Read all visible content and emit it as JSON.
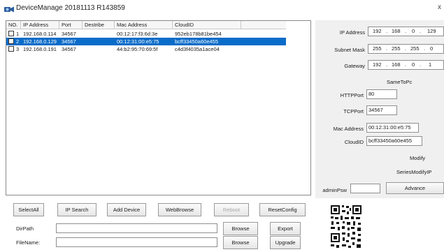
{
  "window": {
    "title": "DeviceManage 20181113 R143859",
    "app_icon": "camera-app-icon",
    "close_glyph": "x"
  },
  "device_list": {
    "columns": [
      "NO.",
      "IP Address",
      "Port",
      "Destribe",
      "Mac Address",
      "CloudID"
    ],
    "rows": [
      {
        "no": "1",
        "ip": "192.168.0.114",
        "port": "34567",
        "describe": "",
        "mac": "00:12:17:f3:6d:3e",
        "cloud": "952eb178b81be454",
        "checked": false,
        "selected": false
      },
      {
        "no": "2",
        "ip": "192.168.0.129",
        "port": "34567",
        "describe": "",
        "mac": "00:12:31:00:e5:75",
        "cloud": "bcff33450a60e455",
        "checked": false,
        "selected": true
      },
      {
        "no": "3",
        "ip": "192.168.0.191",
        "port": "34567",
        "describe": "",
        "mac": "44:b2:95:70:69:5f",
        "cloud": "c4d3f4035a1ace04",
        "checked": false,
        "selected": false
      }
    ],
    "selected_color": "#0a6cc9"
  },
  "buttons": {
    "select_all": "SelectAll",
    "ip_search": "IP Search",
    "add_device": "Add Device",
    "web_browse": "WebBrowse",
    "reboot": "Reboot",
    "reset_config": "ResetConfig",
    "browse_dir": "Browse",
    "export": "Export",
    "browse_file": "Browse",
    "upgrade": "Upgrade"
  },
  "paths": {
    "dir_label": "DirPath",
    "dir_value": "",
    "file_label": "FileName:",
    "file_value": ""
  },
  "config_panel": {
    "ip_label": "IP Address",
    "ip": [
      "192",
      "168",
      "0",
      "129"
    ],
    "mask_label": "Subnet Mask",
    "mask": [
      "255",
      "255",
      "255",
      "0"
    ],
    "gateway_label": "Gateway",
    "gateway": [
      "192",
      "168",
      "0",
      "1"
    ],
    "same_to_pc": "SameToPc",
    "http_port_label": "HTTPPort",
    "http_port": "80",
    "tcp_port_label": "TCPPort",
    "tcp_port": "34567",
    "mac_label": "Mac Address",
    "mac": "00:12:31:00:e5:75",
    "cloud_label": "CloudID",
    "cloud": "bcff33450a60e455",
    "modify": "Modify",
    "series_modify": "SeriesModifyIP",
    "admin_psw_label": "adminPsw",
    "admin_psw": "",
    "advance": "Advance"
  },
  "qr": {
    "icon": "qr-code-icon"
  }
}
